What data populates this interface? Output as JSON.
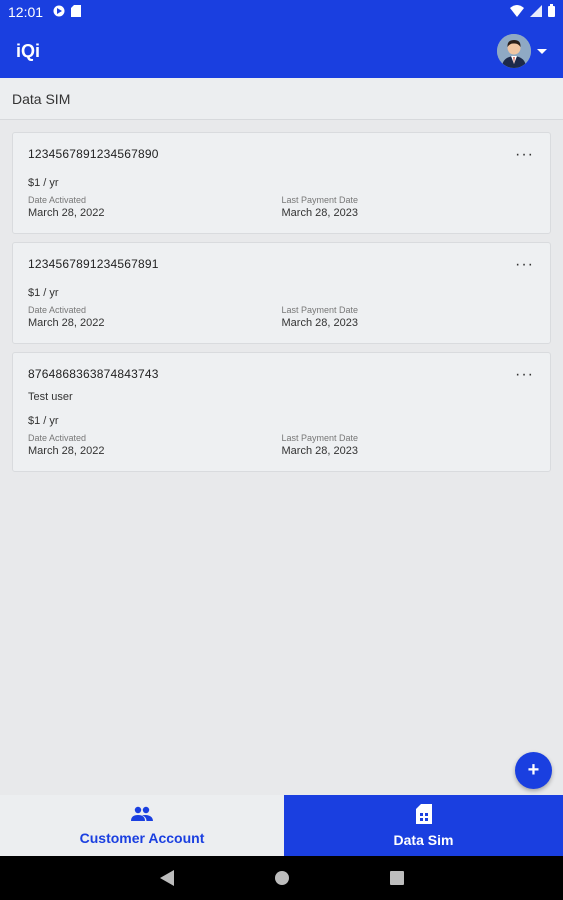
{
  "status_bar": {
    "time": "12:01",
    "icons": [
      "location-icon",
      "sd-card-icon",
      "wifi-icon",
      "signal-icon",
      "battery-icon"
    ]
  },
  "app_bar": {
    "title": "iQi"
  },
  "section": {
    "title": "Data SIM"
  },
  "cards": [
    {
      "number": "1234567891234567890",
      "name": "",
      "price": "$1 / yr",
      "date_activated_label": "Date Activated",
      "date_activated": "March 28, 2022",
      "last_payment_label": "Last Payment Date",
      "last_payment": "March 28, 2023"
    },
    {
      "number": "1234567891234567891",
      "name": "",
      "price": "$1 / yr",
      "date_activated_label": "Date Activated",
      "date_activated": "March 28, 2022",
      "last_payment_label": "Last Payment Date",
      "last_payment": "March 28, 2023"
    },
    {
      "number": "8764868363874843743",
      "name": "Test user",
      "price": "$1 / yr",
      "date_activated_label": "Date Activated",
      "date_activated": "March 28, 2022",
      "last_payment_label": "Last Payment Date",
      "last_payment": "March 28, 2023"
    }
  ],
  "fab": {
    "label": "+"
  },
  "bottom_nav": {
    "items": [
      {
        "label": "Customer Account",
        "icon": "people-icon",
        "active": false
      },
      {
        "label": "Data Sim",
        "icon": "sim-card-icon",
        "active": true
      }
    ]
  },
  "colors": {
    "primary": "#1a3fe0",
    "background": "#e8e9eb",
    "card": "#eef0f2"
  }
}
